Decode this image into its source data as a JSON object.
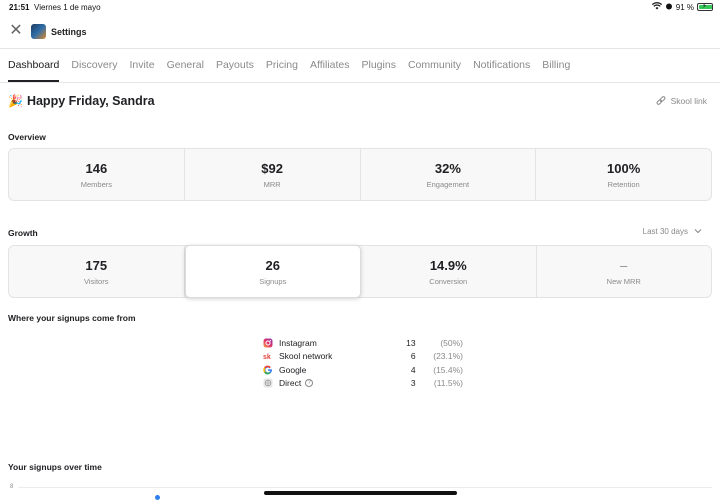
{
  "statusbar": {
    "time": "21:51",
    "date": "Viernes 1 de mayo",
    "battery": "91 %",
    "battery_level": 0.91
  },
  "header": {
    "title": "Settings"
  },
  "tabs": [
    {
      "label": "Dashboard",
      "active": true
    },
    {
      "label": "Discovery"
    },
    {
      "label": "Invite"
    },
    {
      "label": "General"
    },
    {
      "label": "Payouts"
    },
    {
      "label": "Pricing"
    },
    {
      "label": "Affiliates"
    },
    {
      "label": "Plugins"
    },
    {
      "label": "Community"
    },
    {
      "label": "Notifications"
    },
    {
      "label": "Billing"
    }
  ],
  "greeting": {
    "emoji": "🎉",
    "text": "Happy Friday, Sandra"
  },
  "skool_link": "Skool link",
  "overview": {
    "label": "Overview",
    "stats": [
      {
        "value": "146",
        "label": "Members"
      },
      {
        "value": "$92",
        "label": "MRR"
      },
      {
        "value": "32%",
        "label": "Engagement"
      },
      {
        "value": "100%",
        "label": "Retention"
      }
    ]
  },
  "growth": {
    "label": "Growth",
    "range": "Last 30 days",
    "stats": [
      {
        "value": "175",
        "label": "Visitors"
      },
      {
        "value": "26",
        "label": "Signups",
        "selected": true
      },
      {
        "value": "14.9%",
        "label": "Conversion"
      },
      {
        "value": "–",
        "label": "New MRR"
      }
    ]
  },
  "sources": {
    "label": "Where your signups come from",
    "items": [
      {
        "name": "Instagram",
        "count": "13",
        "pct": "(50%)",
        "icon": "instagram-icon"
      },
      {
        "name": "Skool network",
        "count": "6",
        "pct": "(23.1%)",
        "icon": "skool-icon"
      },
      {
        "name": "Google",
        "count": "4",
        "pct": "(15.4%)",
        "icon": "google-icon"
      },
      {
        "name": "Direct",
        "count": "3",
        "pct": "(11.5%)",
        "icon": "direct-icon"
      }
    ]
  },
  "over_time": {
    "label": "Your signups over time",
    "y_tick": "8"
  },
  "colors": {
    "accent": "#2f80ed",
    "text": "#202124",
    "muted": "#8a8a8a",
    "border": "#e3e3e3"
  }
}
